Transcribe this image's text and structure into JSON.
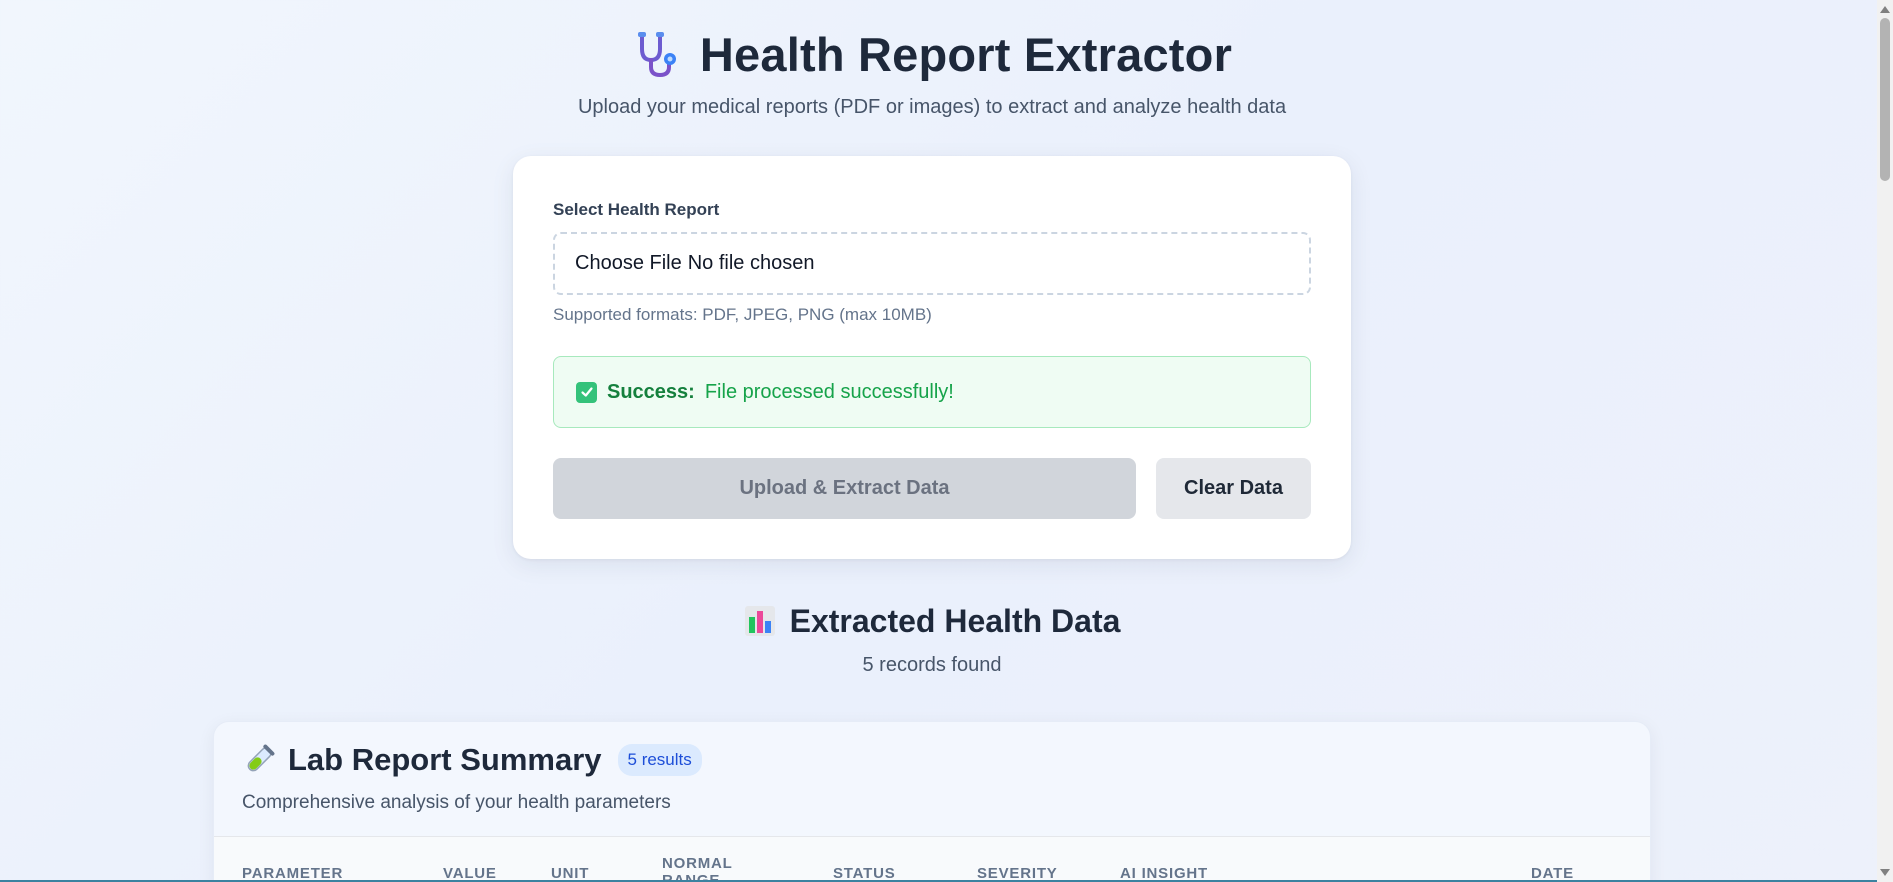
{
  "header": {
    "icon": "stethoscope-icon",
    "title": "Health Report Extractor",
    "subtitle": "Upload your medical reports (PDF or images) to extract and analyze health data"
  },
  "upload_card": {
    "field_label": "Select Health Report",
    "file_input": {
      "button_text": "Choose File",
      "status_text": "No file chosen"
    },
    "hint": "Supported formats: PDF, JPEG, PNG (max 10MB)",
    "alert": {
      "icon": "check-icon",
      "label": "Success:",
      "message": "File processed successfully!"
    },
    "upload_button": "Upload & Extract Data",
    "clear_button": "Clear Data"
  },
  "extracted": {
    "icon": "bar-chart-icon",
    "title": "Extracted Health Data",
    "count_text": "5 records found"
  },
  "lab_summary": {
    "icon": "test-tube-icon",
    "title": "Lab Report Summary",
    "badge": "5 results",
    "subtitle": "Comprehensive analysis of your health parameters",
    "columns": [
      "Parameter",
      "Value",
      "Unit",
      "Normal Range",
      "Status",
      "Severity",
      "AI Insight",
      "Date"
    ]
  },
  "colors": {
    "success_green": "#16a34a",
    "badge_blue": "#1d4ed8",
    "disabled_button": "#d1d5db"
  }
}
